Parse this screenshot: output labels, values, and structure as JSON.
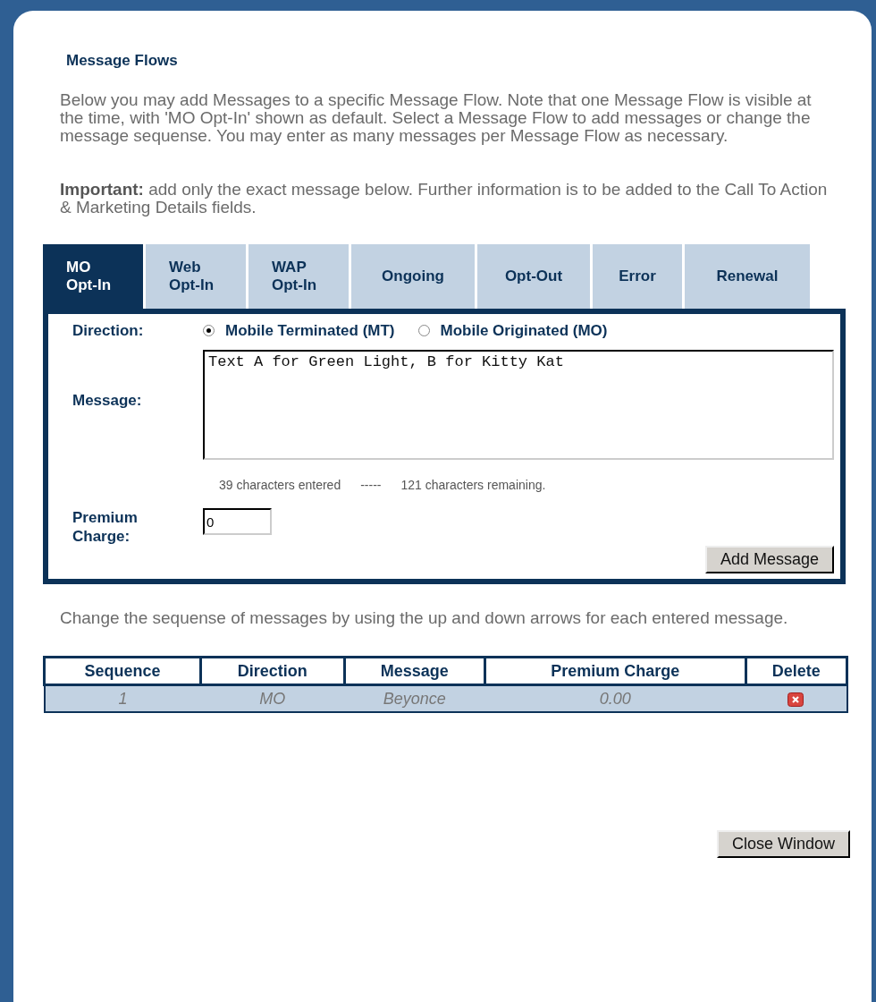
{
  "title": "Message Flows",
  "intro": "Below you may add Messages to a specific Message Flow. Note that one Message Flow is visible at the time, with 'MO Opt-In' shown as default. Select a Message Flow to add messages or change the message sequense. You may enter as many messages per Message Flow as necessary.",
  "important": "**Important:** add only the exact message below. Further information is to be added to the Call To Action & Marketing Details fields.",
  "tabs": [
    {
      "label": "MO\nOpt-In",
      "selected": true
    },
    {
      "label": "Web\nOpt-In",
      "selected": false
    },
    {
      "label": "WAP\nOpt-In",
      "selected": false
    },
    {
      "label": "Ongoing",
      "selected": false
    },
    {
      "label": "Opt-Out",
      "selected": false
    },
    {
      "label": "Error",
      "selected": false
    },
    {
      "label": "Renewal",
      "selected": false
    }
  ],
  "form": {
    "direction_label": "Direction:",
    "directions": [
      {
        "label": "Mobile Terminated (MT)",
        "selected": true
      },
      {
        "label": "Mobile Originated (MO)",
        "selected": false
      }
    ],
    "message_label": "Message:",
    "message_value": "Text A for Green Light, B for Kitty Kat",
    "counter": [
      "39 characters entered",
      "-----",
      "121 characters remaining."
    ],
    "premium_label": "Premium Charge:",
    "premium_value": "0",
    "add_button": "Add Message"
  },
  "hint": "Change the sequense of messages by using the up and down arrows for each entered message.",
  "table": {
    "columns": [
      "Sequence",
      "Direction",
      "Message",
      "Premium Charge",
      "Delete"
    ],
    "rows": [
      {
        "cells": [
          "1",
          "MO",
          "Beyonce",
          "0.00"
        ]
      }
    ]
  },
  "close_button": "Close Window"
}
